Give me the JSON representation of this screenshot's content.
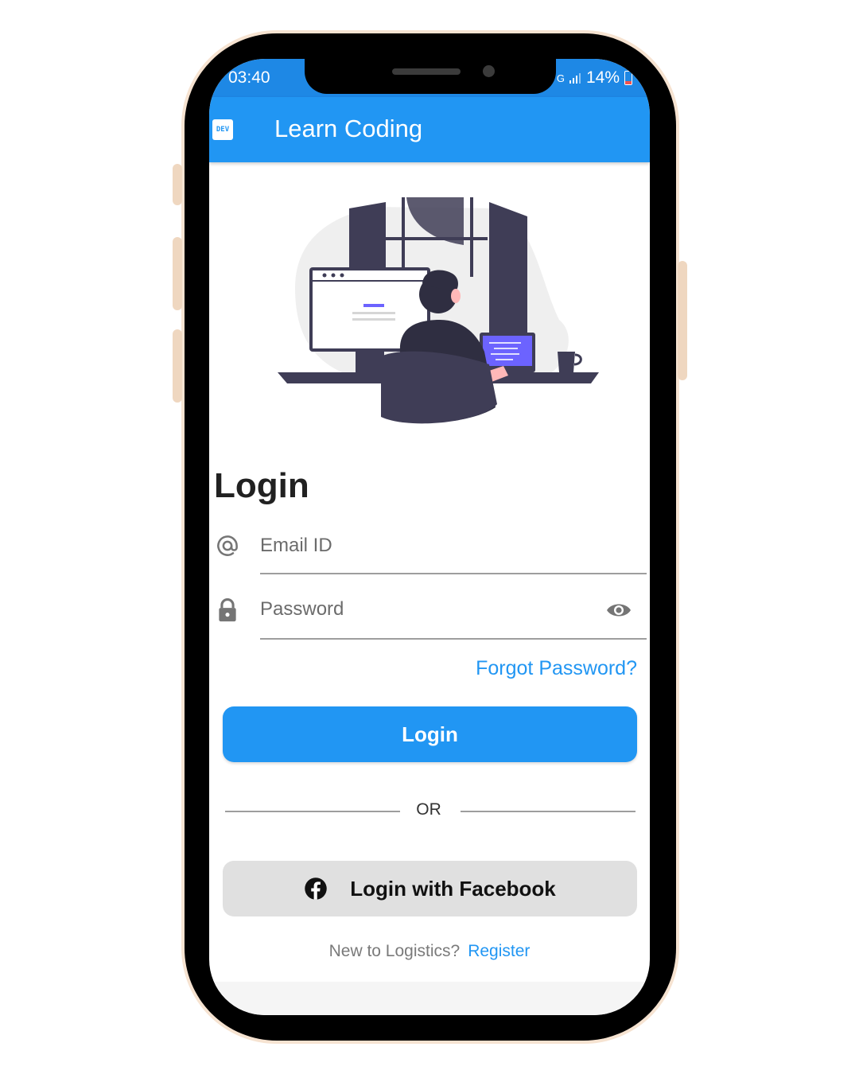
{
  "status_bar": {
    "time": "03:40",
    "network_label": "G",
    "battery_percent": "14%",
    "battery_level": 0.14,
    "icons": [
      "signal-icon",
      "battery-icon"
    ]
  },
  "app_bar": {
    "logo_text": "DEV",
    "title": "Learn Coding"
  },
  "login": {
    "heading": "Login",
    "email": {
      "placeholder": "Email ID",
      "icon": "at-icon"
    },
    "password": {
      "placeholder": "Password",
      "icon": "lock-icon",
      "toggle_icon": "eye-icon"
    },
    "forgot_password": "Forgot Password?",
    "button_label": "Login",
    "divider_text": "OR",
    "facebook_button_label": "Login with Facebook",
    "facebook_icon": "facebook-icon",
    "register_prompt": "New to Logistics?",
    "register_link": "Register"
  },
  "colors": {
    "primary": "#2196f3",
    "status_bar": "#1e88e5",
    "secondary_button": "#e0e0e0",
    "frame": "#000000",
    "frame_trim": "#f6e3d1",
    "illustration_dark": "#3f3d56",
    "illustration_accent": "#6c63ff"
  }
}
